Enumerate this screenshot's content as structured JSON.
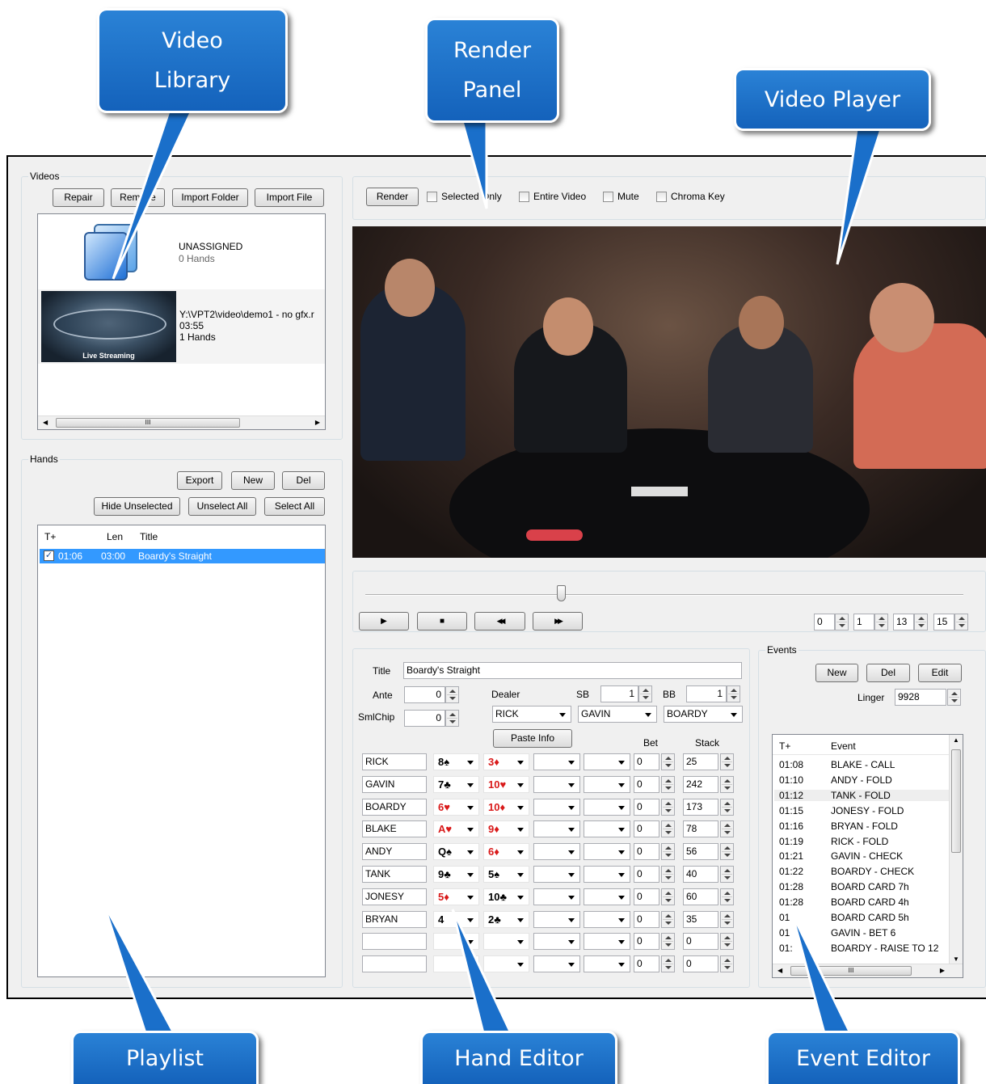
{
  "callouts": {
    "video_library": "Video\nLibrary",
    "render_panel": "Render\nPanel",
    "video_player": "Video Player",
    "playlist": "Playlist",
    "hand_editor": "Hand Editor",
    "event_editor": "Event Editor"
  },
  "videos": {
    "group_label": "Videos",
    "buttons": {
      "repair": "Repair",
      "remove": "Remove",
      "import_folder": "Import Folder",
      "import_file": "Import File"
    },
    "items": [
      {
        "title": "UNASSIGNED",
        "line2": "0 Hands"
      },
      {
        "title": "Y:\\VPT2\\video\\demo1 - no gfx.r",
        "line2": "03:55",
        "line3": "1 Hands",
        "thumb_caption": "Live Streaming"
      }
    ],
    "scroll_marker": "III"
  },
  "hands": {
    "group_label": "Hands",
    "buttons": {
      "export": "Export",
      "new": "New",
      "del": "Del",
      "hide_unselected": "Hide Unselected",
      "unselect_all": "Unselect All",
      "select_all": "Select All"
    },
    "columns": [
      "T+",
      "Len",
      "Title"
    ],
    "rows": [
      {
        "t": "01:06",
        "len": "03:00",
        "title": "Boardy's Straight",
        "checked": true
      }
    ]
  },
  "render": {
    "button": "Render",
    "selected_only": "Selected Only",
    "entire_video": "Entire Video",
    "mute": "Mute",
    "chroma_key": "Chroma Key"
  },
  "player": {
    "play": "▶",
    "stop": "■",
    "rewind": "◀◀",
    "ffwd": "▶▶",
    "slider_pos": 0.32,
    "time": [
      "0",
      "1",
      "13",
      "15"
    ]
  },
  "hand_editor": {
    "title_label": "Title",
    "title_value": "Boardy's Straight",
    "ante_label": "Ante",
    "ante_value": "0",
    "smlchip_label": "SmlChip",
    "smlchip_value": "0",
    "dealer_label": "Dealer",
    "dealer_value": "RICK",
    "sb_label": "SB",
    "sb_value": "1",
    "bb_label": "BB",
    "bb_value": "1",
    "sb_player": "GAVIN",
    "bb_player": "BOARDY",
    "paste_info": "Paste Info",
    "bet_header": "Bet",
    "stack_header": "Stack",
    "players": [
      {
        "name": "RICK",
        "c1": "8♠",
        "c1red": false,
        "c2": "3♦",
        "c2red": true,
        "bet": "0",
        "stack": "25"
      },
      {
        "name": "GAVIN",
        "c1": "7♣",
        "c1red": false,
        "c2": "10♥",
        "c2red": true,
        "bet": "0",
        "stack": "242"
      },
      {
        "name": "BOARDY",
        "c1": "6♥",
        "c1red": true,
        "c2": "10♦",
        "c2red": true,
        "bet": "0",
        "stack": "173"
      },
      {
        "name": "BLAKE",
        "c1": "A♥",
        "c1red": true,
        "c2": "9♦",
        "c2red": true,
        "bet": "0",
        "stack": "78"
      },
      {
        "name": "ANDY",
        "c1": "Q♠",
        "c1red": false,
        "c2": "6♦",
        "c2red": true,
        "bet": "0",
        "stack": "56"
      },
      {
        "name": "TANK",
        "c1": "9♣",
        "c1red": false,
        "c2": "5♠",
        "c2red": false,
        "bet": "0",
        "stack": "40"
      },
      {
        "name": "JONESY",
        "c1": "5♦",
        "c1red": true,
        "c2": "10♣",
        "c2red": false,
        "bet": "0",
        "stack": "60"
      },
      {
        "name": "BRYAN",
        "c1": "4",
        "c1red": false,
        "c2": "2♣",
        "c2red": false,
        "bet": "0",
        "stack": "35"
      },
      {
        "name": "",
        "c1": "",
        "c1red": false,
        "c2": "",
        "c2red": false,
        "bet": "0",
        "stack": "0"
      },
      {
        "name": "",
        "c1": "",
        "c1red": false,
        "c2": "",
        "c2red": false,
        "bet": "0",
        "stack": "0"
      }
    ]
  },
  "events": {
    "group_label": "Events",
    "buttons": {
      "new": "New",
      "del": "Del",
      "edit": "Edit"
    },
    "linger_label": "Linger",
    "linger_value": "9928",
    "columns": [
      "T+",
      "Event"
    ],
    "rows": [
      {
        "t": "01:08",
        "e": "BLAKE - CALL"
      },
      {
        "t": "01:10",
        "e": "ANDY - FOLD"
      },
      {
        "t": "01:12",
        "e": "TANK - FOLD"
      },
      {
        "t": "01:15",
        "e": "JONESY - FOLD"
      },
      {
        "t": "01:16",
        "e": "BRYAN - FOLD"
      },
      {
        "t": "01:19",
        "e": "RICK - FOLD"
      },
      {
        "t": "01:21",
        "e": "GAVIN - CHECK"
      },
      {
        "t": "01:22",
        "e": "BOARDY - CHECK"
      },
      {
        "t": "01:28",
        "e": "BOARD CARD 7h"
      },
      {
        "t": "01:28",
        "e": "BOARD CARD 4h"
      },
      {
        "t": "01",
        "e": "BOARD CARD 5h"
      },
      {
        "t": "01",
        "e": "GAVIN - BET 6"
      },
      {
        "t": "01:",
        "e": "BOARDY - RAISE TO 12"
      }
    ],
    "scroll_marker": "III"
  }
}
